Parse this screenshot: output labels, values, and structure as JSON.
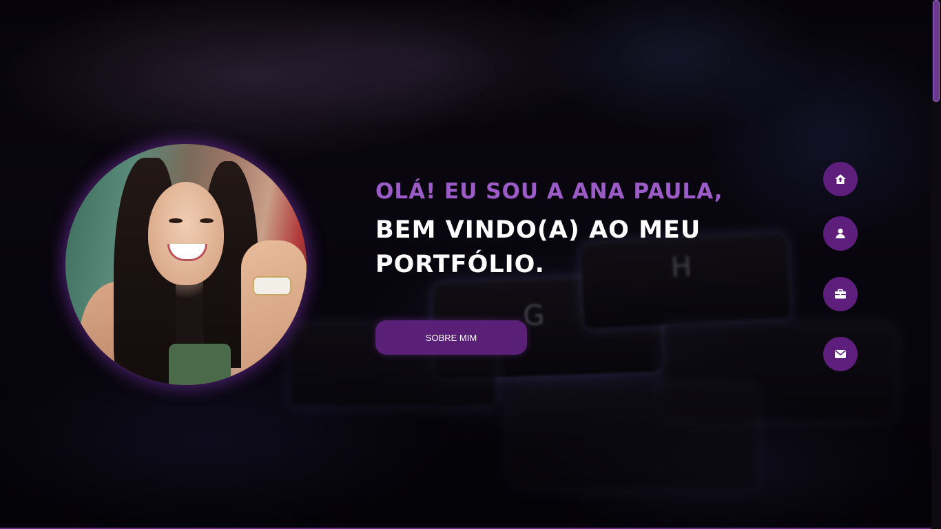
{
  "hero": {
    "greeting": "OLÁ! EU SOU A ANA PAULA,",
    "welcome": "BEM VINDO(A) AO MEU PORTFÓLIO.",
    "cta_label": "SOBRE MIM"
  },
  "side_nav": {
    "items": [
      {
        "icon": "home-icon"
      },
      {
        "icon": "user-icon"
      },
      {
        "icon": "briefcase-icon"
      },
      {
        "icon": "envelope-icon"
      }
    ]
  },
  "background": {
    "key_letters": [
      "G",
      "H"
    ]
  },
  "colors": {
    "accent": "#9b5cc8",
    "button": "#5a1f76",
    "nav_button": "#5e1f7c",
    "text": "#ffffff"
  }
}
